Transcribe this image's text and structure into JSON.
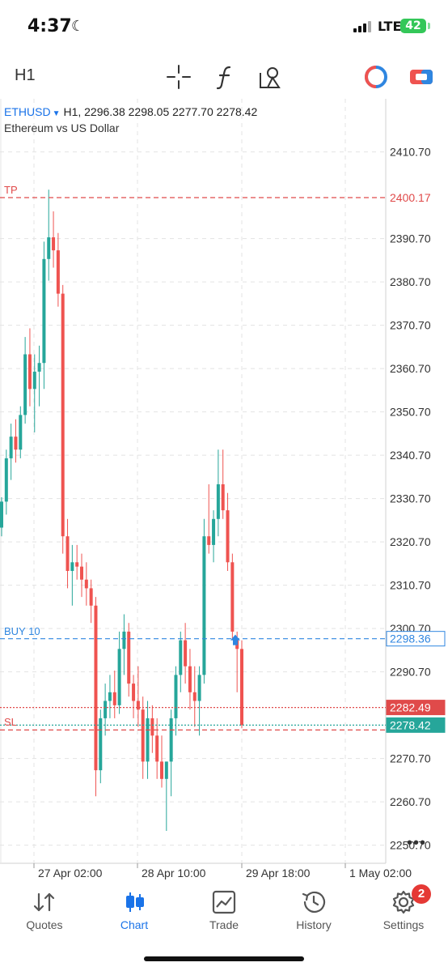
{
  "status_bar": {
    "time": "4:37",
    "network": "LTE",
    "battery": "42"
  },
  "toolbar": {
    "timeframe": "H1",
    "tools": [
      "crosshair-icon",
      "function-icon",
      "objects-icon",
      "trade-circle-icon",
      "one-click-trading-icon"
    ]
  },
  "chart_header": {
    "symbol": "ETHUSD",
    "line1": "H1, 2296.38 2298.05 2277.70 2278.42",
    "description": "Ethereum vs US Dollar"
  },
  "price_axis": {
    "ticks": [
      "2410.70",
      "2390.70",
      "2380.70",
      "2370.70",
      "2360.70",
      "2350.70",
      "2340.70",
      "2330.70",
      "2320.70",
      "2310.70",
      "2300.70",
      "2290.70",
      "2270.70",
      "2260.70",
      "2250.70"
    ],
    "tick_values": [
      2410.7,
      2390.7,
      2380.7,
      2370.7,
      2360.7,
      2350.7,
      2340.7,
      2330.7,
      2320.7,
      2310.7,
      2300.7,
      2290.7,
      2270.7,
      2260.7,
      2250.7
    ]
  },
  "time_axis": {
    "labels": [
      "27 Apr 02:00",
      "28 Apr 10:00",
      "29 Apr 18:00",
      "1 May 02:00"
    ]
  },
  "levels": {
    "tp": {
      "label": "TP",
      "price": "2400.17",
      "value": 2400.17,
      "color": "#e04a4a"
    },
    "buy": {
      "label": "BUY 10",
      "price": "2298.36",
      "value": 2298.36,
      "color": "#2f86e0"
    },
    "ask": {
      "price": "2282.49",
      "value": 2282.49,
      "color": "#e04a4a"
    },
    "sl": {
      "label": "SL",
      "value": 2277.3,
      "color": "#e04a4a"
    },
    "bid": {
      "price": "2278.42",
      "value": 2278.42,
      "color": "#26a69a"
    }
  },
  "colors": {
    "bull": "#26a69a",
    "bear": "#ef5350",
    "grid": "#e3e3e3",
    "accent": "#1a73e8"
  },
  "chart_data": {
    "type": "candlestick",
    "symbol": "ETHUSD",
    "timeframe": "H1",
    "ylim": [
      2246,
      2416
    ],
    "candles": [
      {
        "o": 2324,
        "h": 2331,
        "l": 2322,
        "c": 2330
      },
      {
        "o": 2330,
        "h": 2342,
        "l": 2327,
        "c": 2340
      },
      {
        "o": 2340,
        "h": 2348,
        "l": 2335,
        "c": 2345
      },
      {
        "o": 2345,
        "h": 2349,
        "l": 2339,
        "c": 2342
      },
      {
        "o": 2342,
        "h": 2352,
        "l": 2340,
        "c": 2350
      },
      {
        "o": 2350,
        "h": 2368,
        "l": 2348,
        "c": 2364
      },
      {
        "o": 2364,
        "h": 2370,
        "l": 2352,
        "c": 2356
      },
      {
        "o": 2356,
        "h": 2364,
        "l": 2346,
        "c": 2360
      },
      {
        "o": 2360,
        "h": 2366,
        "l": 2352,
        "c": 2362
      },
      {
        "o": 2362,
        "h": 2390,
        "l": 2356,
        "c": 2386
      },
      {
        "o": 2386,
        "h": 2402,
        "l": 2381,
        "c": 2391
      },
      {
        "o": 2391,
        "h": 2397,
        "l": 2384,
        "c": 2388
      },
      {
        "o": 2388,
        "h": 2392,
        "l": 2375,
        "c": 2378
      },
      {
        "o": 2378,
        "h": 2380,
        "l": 2318,
        "c": 2322
      },
      {
        "o": 2322,
        "h": 2326,
        "l": 2310,
        "c": 2314
      },
      {
        "o": 2314,
        "h": 2320,
        "l": 2306,
        "c": 2316
      },
      {
        "o": 2316,
        "h": 2320,
        "l": 2312,
        "c": 2315
      },
      {
        "o": 2315,
        "h": 2318,
        "l": 2308,
        "c": 2312
      },
      {
        "o": 2312,
        "h": 2316,
        "l": 2306,
        "c": 2310
      },
      {
        "o": 2310,
        "h": 2312,
        "l": 2302,
        "c": 2306
      },
      {
        "o": 2306,
        "h": 2308,
        "l": 2262,
        "c": 2268
      },
      {
        "o": 2268,
        "h": 2282,
        "l": 2265,
        "c": 2280
      },
      {
        "o": 2280,
        "h": 2288,
        "l": 2276,
        "c": 2284
      },
      {
        "o": 2284,
        "h": 2290,
        "l": 2280,
        "c": 2286
      },
      {
        "o": 2286,
        "h": 2291,
        "l": 2280,
        "c": 2283
      },
      {
        "o": 2283,
        "h": 2300,
        "l": 2281,
        "c": 2296
      },
      {
        "o": 2296,
        "h": 2304,
        "l": 2290,
        "c": 2300
      },
      {
        "o": 2300,
        "h": 2302,
        "l": 2285,
        "c": 2288
      },
      {
        "o": 2288,
        "h": 2290,
        "l": 2280,
        "c": 2284
      },
      {
        "o": 2284,
        "h": 2292,
        "l": 2278,
        "c": 2282
      },
      {
        "o": 2282,
        "h": 2285,
        "l": 2266,
        "c": 2270
      },
      {
        "o": 2270,
        "h": 2284,
        "l": 2266,
        "c": 2280
      },
      {
        "o": 2280,
        "h": 2283,
        "l": 2272,
        "c": 2276
      },
      {
        "o": 2276,
        "h": 2280,
        "l": 2266,
        "c": 2270
      },
      {
        "o": 2270,
        "h": 2276,
        "l": 2264,
        "c": 2266
      },
      {
        "o": 2266,
        "h": 2270,
        "l": 2254,
        "c": 2270
      },
      {
        "o": 2270,
        "h": 2282,
        "l": 2262,
        "c": 2280
      },
      {
        "o": 2280,
        "h": 2292,
        "l": 2276,
        "c": 2290
      },
      {
        "o": 2290,
        "h": 2300,
        "l": 2286,
        "c": 2298
      },
      {
        "o": 2298,
        "h": 2302,
        "l": 2288,
        "c": 2292
      },
      {
        "o": 2292,
        "h": 2296,
        "l": 2282,
        "c": 2286
      },
      {
        "o": 2286,
        "h": 2292,
        "l": 2278,
        "c": 2284
      },
      {
        "o": 2284,
        "h": 2292,
        "l": 2276,
        "c": 2290
      },
      {
        "o": 2290,
        "h": 2326,
        "l": 2288,
        "c": 2322
      },
      {
        "o": 2322,
        "h": 2334,
        "l": 2318,
        "c": 2320
      },
      {
        "o": 2320,
        "h": 2328,
        "l": 2316,
        "c": 2326
      },
      {
        "o": 2326,
        "h": 2342,
        "l": 2322,
        "c": 2334
      },
      {
        "o": 2334,
        "h": 2342,
        "l": 2326,
        "c": 2328
      },
      {
        "o": 2328,
        "h": 2332,
        "l": 2314,
        "c": 2316
      },
      {
        "o": 2316,
        "h": 2318,
        "l": 2298,
        "c": 2300
      },
      {
        "o": 2298,
        "h": 2300,
        "l": 2286,
        "c": 2296
      },
      {
        "o": 2296,
        "h": 2298,
        "l": 2277.7,
        "c": 2278.42
      }
    ]
  }
}
